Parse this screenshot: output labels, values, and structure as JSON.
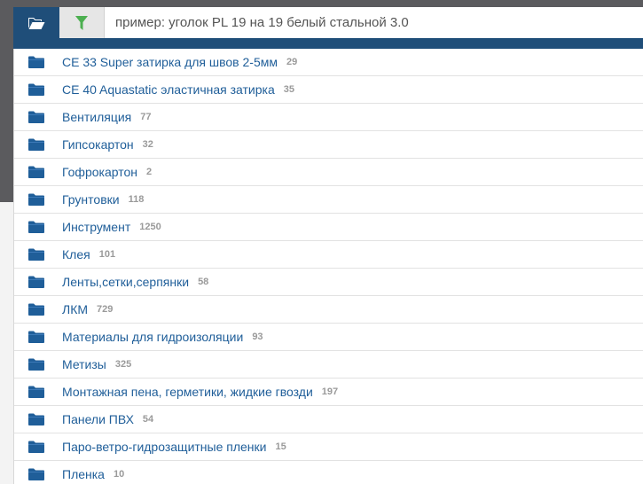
{
  "search": {
    "placeholder": "пример: уголок PL 19 на 19 белый стальной 3.0",
    "value": ""
  },
  "colors": {
    "accent": "#1f4e79",
    "link": "#1f5e99",
    "filter_icon": "#4caf50",
    "count": "#9a9a9a"
  },
  "toolbar": {
    "folder_icon": "folder-open-icon",
    "filter_icon": "filter-icon"
  },
  "list": {
    "items": [
      {
        "label": "CE 33 Super затирка для швов 2-5мм",
        "count": "29"
      },
      {
        "label": "CE 40 Aquastatic эластичная затирка",
        "count": "35"
      },
      {
        "label": "Вентиляция",
        "count": "77"
      },
      {
        "label": "Гипсокартон",
        "count": "32"
      },
      {
        "label": "Гофрокартон",
        "count": "2"
      },
      {
        "label": "Грунтовки",
        "count": "118"
      },
      {
        "label": "Инструмент",
        "count": "1250"
      },
      {
        "label": "Клея",
        "count": "101"
      },
      {
        "label": "Ленты,сетки,серпянки",
        "count": "58"
      },
      {
        "label": "ЛКМ",
        "count": "729"
      },
      {
        "label": "Материалы для гидроизоляции",
        "count": "93"
      },
      {
        "label": "Метизы",
        "count": "325"
      },
      {
        "label": "Монтажная пена, герметики, жидкие гвозди",
        "count": "197"
      },
      {
        "label": "Панели ПВХ",
        "count": "54"
      },
      {
        "label": "Паро-ветро-гидрозащитные пленки",
        "count": "15"
      },
      {
        "label": "Пленка",
        "count": "10"
      }
    ]
  }
}
